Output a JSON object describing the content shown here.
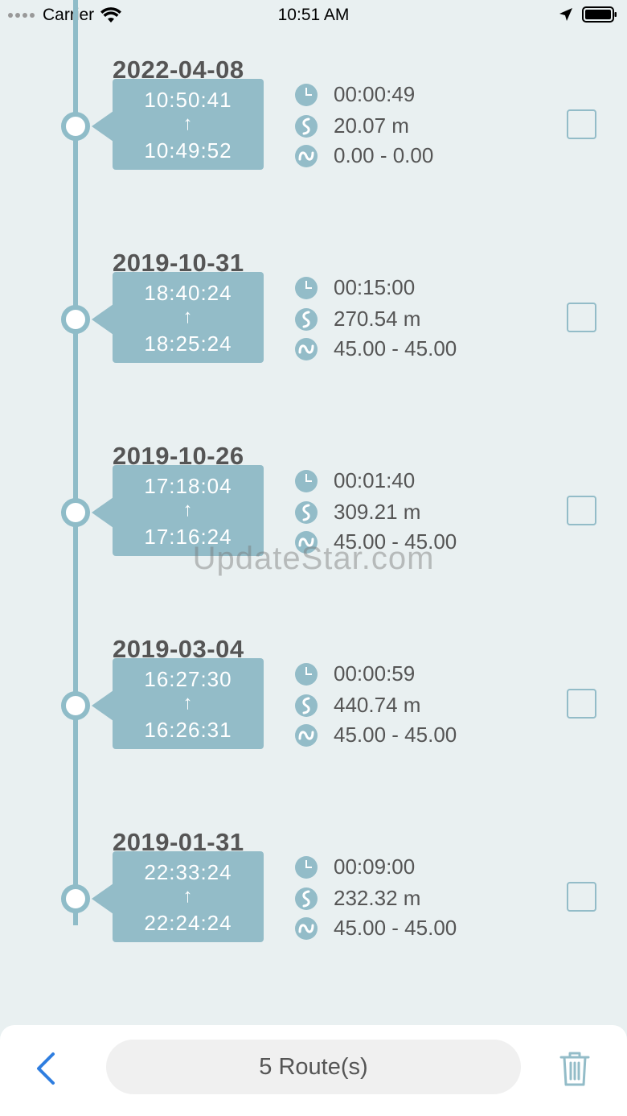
{
  "status_bar": {
    "carrier": "Carrier",
    "time": "10:51 AM"
  },
  "colors": {
    "accent": "#93bcc8",
    "background": "#e9f0f1",
    "back_blue": "#2f7ee0"
  },
  "routes": [
    {
      "date": "2022-04-08",
      "end_time": "10:50:41",
      "arrow": "↑",
      "start_time": "10:49:52",
      "duration": "00:00:49",
      "distance": "20.07 m",
      "speed": "0.00 - 0.00"
    },
    {
      "date": "2019-10-31",
      "end_time": "18:40:24",
      "arrow": "↑",
      "start_time": "18:25:24",
      "duration": "00:15:00",
      "distance": "270.54 m",
      "speed": "45.00 - 45.00"
    },
    {
      "date": "2019-10-26",
      "end_time": "17:18:04",
      "arrow": "↑",
      "start_time": "17:16:24",
      "duration": "00:01:40",
      "distance": "309.21 m",
      "speed": "45.00 - 45.00"
    },
    {
      "date": "2019-03-04",
      "end_time": "16:27:30",
      "arrow": "↑",
      "start_time": "16:26:31",
      "duration": "00:00:59",
      "distance": "440.74 m",
      "speed": "45.00 - 45.00"
    },
    {
      "date": "2019-01-31",
      "end_time": "22:33:24",
      "arrow": "↑",
      "start_time": "22:24:24",
      "duration": "00:09:00",
      "distance": "232.32 m",
      "speed": "45.00 - 45.00"
    }
  ],
  "watermark": "UpdateStar.com",
  "bottom_bar": {
    "route_count": "5 Route(s)"
  },
  "icons": {
    "duration": "clock-icon",
    "distance": "distance-icon",
    "speed": "speed-icon",
    "back": "chevron-left-icon",
    "delete": "trash-icon"
  }
}
